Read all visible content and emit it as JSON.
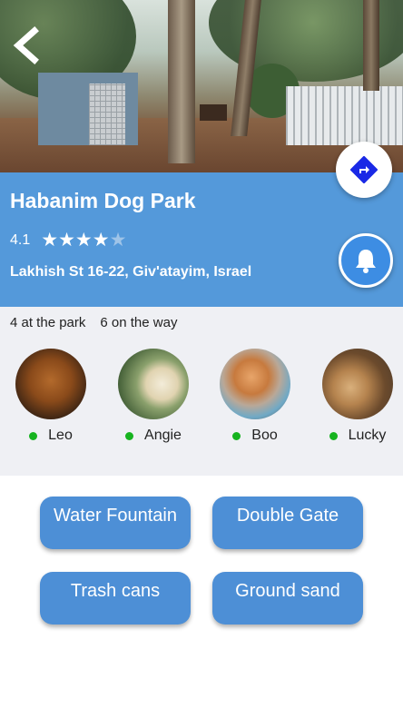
{
  "park": {
    "name": "Habanim Dog Park",
    "rating_value": "4.1",
    "rating": 4.1,
    "rating_max": 5,
    "address": "Lakhish St 16-22, Giv'atayim, Israel"
  },
  "counts": {
    "at_park": "4 at the park",
    "on_the_way": "6 on the way"
  },
  "dogs": [
    {
      "name": "Leo",
      "status": "online"
    },
    {
      "name": "Angie",
      "status": "online"
    },
    {
      "name": "Boo",
      "status": "online"
    },
    {
      "name": "Lucky",
      "status": "online"
    }
  ],
  "amenities": [
    {
      "label": "Water Fountain"
    },
    {
      "label": "Double Gate"
    },
    {
      "label": "Trash cans"
    },
    {
      "label": "Ground sand"
    }
  ],
  "icons": {
    "back": "chevron-left-icon",
    "directions": "directions-icon",
    "bell": "bell-icon"
  },
  "colors": {
    "info_band": "#5499da",
    "amenity_button": "#4d8fd6",
    "bell_button": "#3d8de3",
    "directions_icon": "#1a29e6",
    "status_dot": "#16b31f",
    "panel_bg": "#eff0f4"
  }
}
